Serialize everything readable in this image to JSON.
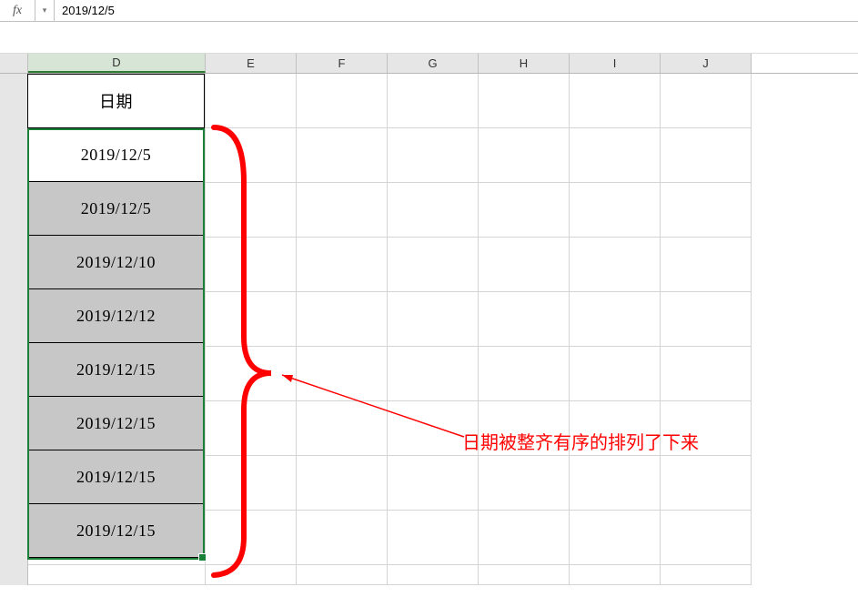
{
  "formula_bar": {
    "fx_label": "fx",
    "dropdown_glyph": "▾",
    "value": "2019/12/5"
  },
  "columns": {
    "labels": [
      "D",
      "E",
      "F",
      "G",
      "H",
      "I",
      "J"
    ],
    "selected_index": 0
  },
  "column_D": {
    "header": "日期",
    "rows": [
      "2019/12/5",
      "2019/12/5",
      "2019/12/10",
      "2019/12/12",
      "2019/12/15",
      "2019/12/15",
      "2019/12/15",
      "2019/12/15"
    ],
    "active_cell_index": 0
  },
  "annotation": {
    "text": "日期被整齐有序的排列了下来",
    "color": "#ff0000"
  },
  "chart_data": {
    "type": "table",
    "title": "日期",
    "columns": [
      "日期"
    ],
    "rows": [
      [
        "2019/12/5"
      ],
      [
        "2019/12/5"
      ],
      [
        "2019/12/10"
      ],
      [
        "2019/12/12"
      ],
      [
        "2019/12/15"
      ],
      [
        "2019/12/15"
      ],
      [
        "2019/12/15"
      ],
      [
        "2019/12/15"
      ]
    ]
  }
}
